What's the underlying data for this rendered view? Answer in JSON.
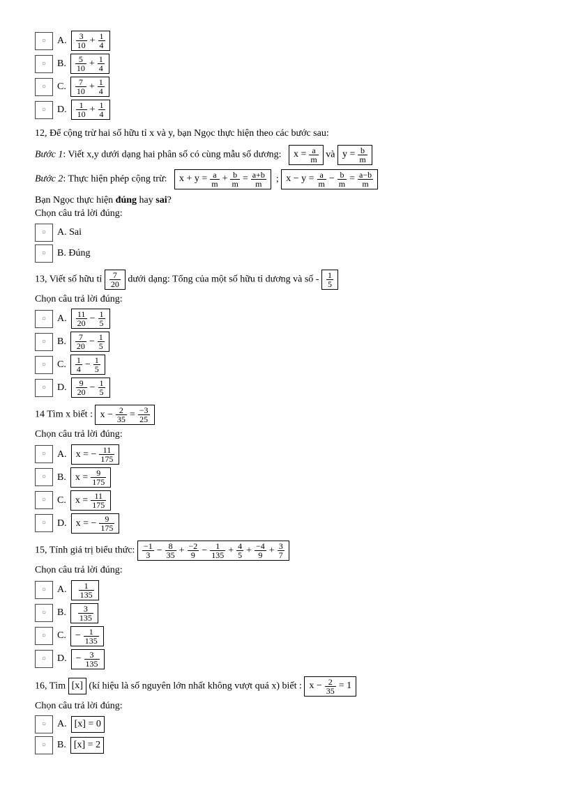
{
  "q11": {
    "options": [
      {
        "label": "A.",
        "frac1": {
          "n": "3",
          "d": "10"
        },
        "plus": "+",
        "frac2": {
          "n": "1",
          "d": "4"
        }
      },
      {
        "label": "B.",
        "frac1": {
          "n": "5",
          "d": "10"
        },
        "plus": "+",
        "frac2": {
          "n": "1",
          "d": "4"
        }
      },
      {
        "label": "C.",
        "frac1": {
          "n": "7",
          "d": "10"
        },
        "plus": "+",
        "frac2": {
          "n": "1",
          "d": "4"
        }
      },
      {
        "label": "D.",
        "frac1": {
          "n": "1",
          "d": "10"
        },
        "plus": "+",
        "frac2": {
          "n": "1",
          "d": "4"
        }
      }
    ]
  },
  "q12": {
    "intro": "12, Để cộng trừ hai số hữu tỉ x và y, bạn Ngọc thực hiện theo các bước sau:",
    "step1_label": "Bước 1",
    "step1_text": ": Viết x,y dưới dạng hai phân số có cùng mẫu số dương:",
    "eq_x": {
      "lhs": "x =",
      "num": "a",
      "den": "m"
    },
    "and": "và",
    "eq_y": {
      "lhs": "y =",
      "num": "b",
      "den": "m"
    },
    "step2_label": "Bước 2",
    "step2_text": ": Thực hiện phép cộng trừ:",
    "eq_sum": {
      "lhs": "x + y =",
      "f1": {
        "n": "a",
        "d": "m"
      },
      "op": "+",
      "f2": {
        "n": "b",
        "d": "m"
      },
      "eq": "=",
      "f3": {
        "n": "a+b",
        "d": "m"
      }
    },
    "sep": ";",
    "eq_diff": {
      "lhs": "x − y =",
      "f1": {
        "n": "a",
        "d": "m"
      },
      "op": "−",
      "f2": {
        "n": "b",
        "d": "m"
      },
      "eq": "=",
      "f3": {
        "n": "a−b",
        "d": "m"
      }
    },
    "ask1": "Bạn Ngọc thực hiện ",
    "bold1": "đúng",
    "ask2": " hay ",
    "bold2": "sai",
    "ask3": "?",
    "choose": "Chọn câu trả lời đúng:",
    "optA": "A. Sai",
    "optB": "B. Đúng"
  },
  "q13": {
    "pre": "13, Viết số hữu tỉ ",
    "main_frac": {
      "n": "7",
      "d": "20"
    },
    "mid": "dưới dạng:      Tổng của một số hữu tỉ dương và số -",
    "neg_frac": {
      "n": "1",
      "d": "5"
    },
    "choose": "Chọn câu trả lời đúng:",
    "options": [
      {
        "label": "A.",
        "frac1": {
          "n": "11",
          "d": "20"
        },
        "op": "−",
        "frac2": {
          "n": "1",
          "d": "5"
        }
      },
      {
        "label": "B.",
        "frac1": {
          "n": "7",
          "d": "20"
        },
        "op": "−",
        "frac2": {
          "n": "1",
          "d": "5"
        }
      },
      {
        "label": "C.",
        "frac1": {
          "n": "1",
          "d": "4"
        },
        "op": "−",
        "frac2": {
          "n": "1",
          "d": "5"
        }
      },
      {
        "label": "D.",
        "frac1": {
          "n": "9",
          "d": "20"
        },
        "op": "−",
        "frac2": {
          "n": "1",
          "d": "5"
        }
      }
    ]
  },
  "q14": {
    "pre": "14  Tìm x biết : ",
    "eq": {
      "lhs": "x −",
      "f1": {
        "n": "2",
        "d": "35"
      },
      "mid": "=",
      "f2": {
        "n": "−3",
        "d": "25"
      }
    },
    "choose": "Chọn câu trả lời đúng:",
    "options": [
      {
        "label": "A.",
        "expr": "x = −",
        "frac": {
          "n": "11",
          "d": "175"
        }
      },
      {
        "label": "B.",
        "expr": "x =",
        "frac": {
          "n": "9",
          "d": "175"
        }
      },
      {
        "label": "C.",
        "expr": "x =",
        "frac": {
          "n": "11",
          "d": "175"
        }
      },
      {
        "label": "D.",
        "expr": "x = −",
        "frac": {
          "n": "9",
          "d": "175"
        }
      }
    ]
  },
  "q15": {
    "pre": "15, Tính giá trị biểu thức: ",
    "terms": [
      {
        "n": "−1",
        "d": "3"
      },
      {
        "op": "−"
      },
      {
        "n": "8",
        "d": "35"
      },
      {
        "op": "+"
      },
      {
        "n": "−2",
        "d": "9"
      },
      {
        "op": "−"
      },
      {
        "n": "1",
        "d": "135"
      },
      {
        "op": "+"
      },
      {
        "n": "4",
        "d": "5"
      },
      {
        "op": "+"
      },
      {
        "n": "−4",
        "d": "9"
      },
      {
        "op": "+"
      },
      {
        "n": "3",
        "d": "7"
      }
    ],
    "choose": "Chọn câu trả lời đúng:",
    "options": [
      {
        "label": "A.",
        "sign": "",
        "frac": {
          "n": "1",
          "d": "135"
        }
      },
      {
        "label": "B.",
        "sign": "",
        "frac": {
          "n": "3",
          "d": "135"
        }
      },
      {
        "label": "C.",
        "sign": "−",
        "frac": {
          "n": "1",
          "d": "135"
        }
      },
      {
        "label": "D.",
        "sign": "−",
        "frac": {
          "n": "3",
          "d": "135"
        }
      }
    ]
  },
  "q16": {
    "pre": "16, Tìm ",
    "sym": "[x]",
    "mid": "(kí hiệu là số nguyên lớn nhất không vượt quá x) biết : ",
    "eq": {
      "lhs": "x −",
      "f1": {
        "n": "2",
        "d": "35"
      },
      "rhs": "= 1"
    },
    "choose": "Chọn câu trả lời đúng:",
    "options": [
      {
        "label": "A.",
        "expr": "[x] = 0"
      },
      {
        "label": "B.",
        "expr": "[x] = 2"
      }
    ]
  }
}
